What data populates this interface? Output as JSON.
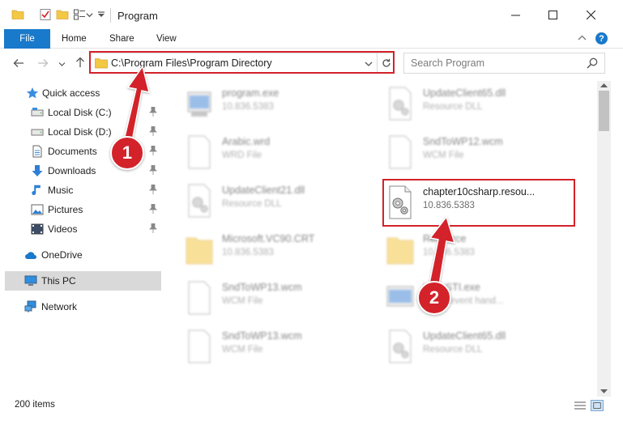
{
  "window": {
    "title": "Program",
    "controls": {
      "minimize": "minimize-icon",
      "maximize": "maximize-icon",
      "close": "close-icon"
    }
  },
  "ribbon": {
    "tabs": [
      {
        "label": "File",
        "active": true
      },
      {
        "label": "Home"
      },
      {
        "label": "Share"
      },
      {
        "label": "View"
      }
    ],
    "help_label": "?"
  },
  "address": {
    "path": "C:\\Program Files\\Program Directory",
    "search_placeholder": "Search Program"
  },
  "sidebar": {
    "items": [
      {
        "label": "Quick access",
        "icon": "star-icon"
      },
      {
        "label": "Local Disk (C:)",
        "icon": "drive-icon",
        "pinned": true
      },
      {
        "label": "Local Disk (D:)",
        "icon": "drive-icon",
        "pinned": true
      },
      {
        "label": "Documents",
        "icon": "documents-icon",
        "pinned": true
      },
      {
        "label": "Downloads",
        "icon": "download-icon",
        "pinned": true
      },
      {
        "label": "Music",
        "icon": "music-icon",
        "pinned": true
      },
      {
        "label": "Pictures",
        "icon": "pictures-icon",
        "pinned": true
      },
      {
        "label": "Videos",
        "icon": "videos-icon",
        "pinned": true
      },
      {
        "label": "OneDrive",
        "icon": "cloud-icon"
      },
      {
        "label": "This PC",
        "icon": "computer-icon",
        "selected": true
      },
      {
        "label": "Network",
        "icon": "network-icon"
      }
    ]
  },
  "files": {
    "left": [
      {
        "name": "program.exe",
        "sub": "10.836.5383",
        "type": "exe"
      },
      {
        "name": "Arabic.wrd",
        "sub": "WRD File",
        "type": "doc"
      },
      {
        "name": "UpdateClient21.dll",
        "sub": "Resource DLL",
        "type": "dll"
      },
      {
        "name": "Microsoft.VC90.CRT",
        "sub": "10.836.5383",
        "type": "folder"
      },
      {
        "name": "SndToWP13.wcm",
        "sub": "WCM File",
        "type": "doc"
      },
      {
        "name": "SndToWP13.wcm",
        "sub": "WCM File",
        "type": "doc"
      }
    ],
    "right": [
      {
        "name": "UpdateClient65.dll",
        "sub": "Resource DLL",
        "type": "dll"
      },
      {
        "name": "SndToWP12.wcm",
        "sub": "WCM File",
        "type": "doc"
      },
      {
        "name": "chapter10csharp.resou...",
        "sub": "10.836.5383",
        "type": "dll",
        "highlighted": true
      },
      {
        "name": "Resource",
        "sub": "10.836.5383",
        "type": "folder"
      },
      {
        "name": "KeyySTI.exe",
        "sub": "KT ok event hand...",
        "type": "exe"
      },
      {
        "name": "UpdateClient65.dll",
        "sub": "Resource DLL",
        "type": "dll"
      }
    ]
  },
  "status": {
    "item_count": "200 items"
  },
  "markers": [
    {
      "label": "1"
    },
    {
      "label": "2"
    }
  ],
  "colors": {
    "accent": "#1979ca",
    "highlight": "#d3222a",
    "folder": "#f3c845"
  }
}
